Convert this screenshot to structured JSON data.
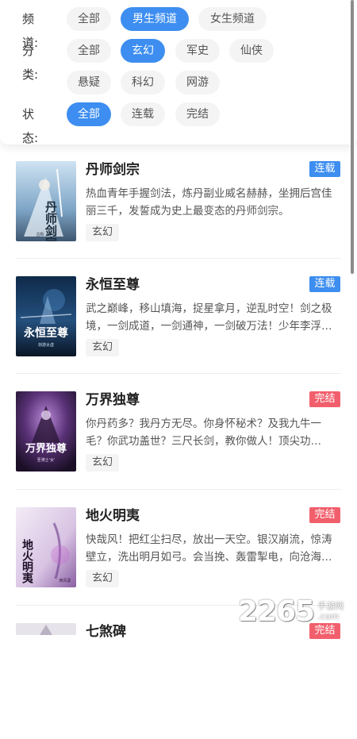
{
  "filters": {
    "channel": {
      "label": "频道:",
      "options": [
        "全部",
        "男生频道",
        "女生频道"
      ],
      "selected": "男生频道"
    },
    "category": {
      "label": "分类:",
      "options": [
        "全部",
        "玄幻",
        "军史",
        "仙侠",
        "悬疑",
        "科幻",
        "网游"
      ],
      "selected": "玄幻"
    },
    "status": {
      "label": "状态:",
      "options": [
        "全部",
        "连载",
        "完结"
      ],
      "selected": "全部"
    }
  },
  "books": [
    {
      "title": "丹师剑宗",
      "status": "连载",
      "description": "热血青年手握剑法，炼丹副业威名赫赫，坐拥后宫佳丽三千，发誓成为史上最变态的丹师剑宗。",
      "tag": "玄幻",
      "cover_title": "丹师剑宗",
      "cover_author": "古栎 · 作品"
    },
    {
      "title": "永恒至尊",
      "status": "连载",
      "description": "武之巅峰，移山填海，捉星拿月，逆乱时空！剑之极境，一剑成道，一剑通神，一剑破万法！少年李浮…",
      "tag": "玄幻",
      "cover_title": "永恒至尊",
      "cover_author": "剑游太虚"
    },
    {
      "title": "万界独尊",
      "status": "完结",
      "description": "你丹药多？我丹方无尽。你身怀秘术？及我九牛一毛？你武功盖世？三尺长剑，教你做人！顶尖功…",
      "tag": "玄幻",
      "cover_title": "万界独尊",
      "cover_author": "圣骑士'女'"
    },
    {
      "title": "地火明夷",
      "status": "完结",
      "description": "快哉风！把红尘扫尽，放出一天空。银汉崩流，惊涛壁立，洗出明月如弓。会当挽、轰雷掣电，向沧海…",
      "tag": "玄幻",
      "cover_title": "地火明夷",
      "cover_author": "西风紧"
    },
    {
      "title": "七煞碑",
      "status": "完结",
      "description": "",
      "tag": ""
    }
  ],
  "watermark": {
    "number": "2265",
    "suffix_top": "手游网",
    "suffix_bottom": ".com"
  },
  "colors": {
    "accent": "#3d8ef0",
    "ongoing_badge": "#3d8ef0",
    "completed_badge": "#f25f6c",
    "chip_bg": "#f4f4f4"
  }
}
